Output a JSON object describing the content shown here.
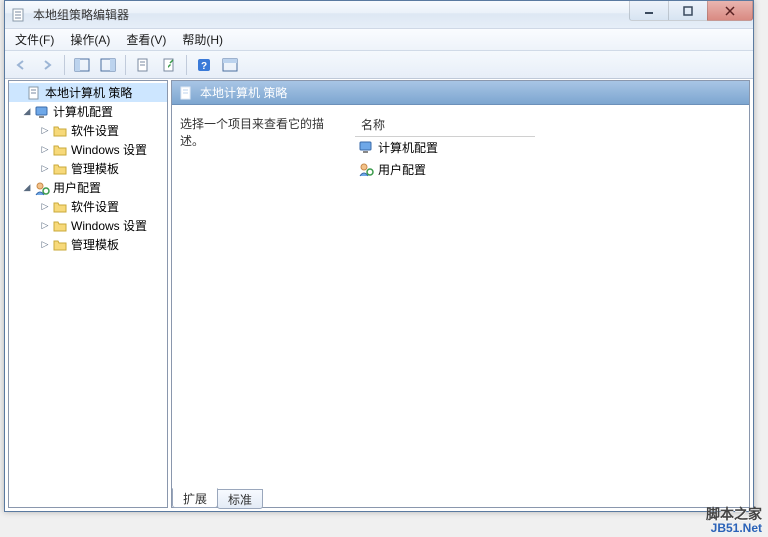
{
  "title": "本地组策略编辑器",
  "menu": {
    "file": "文件(F)",
    "action": "操作(A)",
    "view": "查看(V)",
    "help": "帮助(H)"
  },
  "tree": {
    "root": "本地计算机 策略",
    "computer": {
      "label": "计算机配置",
      "software": "软件设置",
      "windows": "Windows 设置",
      "templates": "管理模板"
    },
    "user": {
      "label": "用户配置",
      "software": "软件设置",
      "windows": "Windows 设置",
      "templates": "管理模板"
    }
  },
  "right": {
    "header": "本地计算机 策略",
    "desc": "选择一个项目来查看它的描述。",
    "column_name": "名称",
    "items": {
      "computer": "计算机配置",
      "user": "用户配置"
    },
    "tabs": {
      "extended": "扩展",
      "standard": "标准"
    }
  },
  "watermark": {
    "cn": "脚本之家",
    "en": "JB51.Net"
  }
}
